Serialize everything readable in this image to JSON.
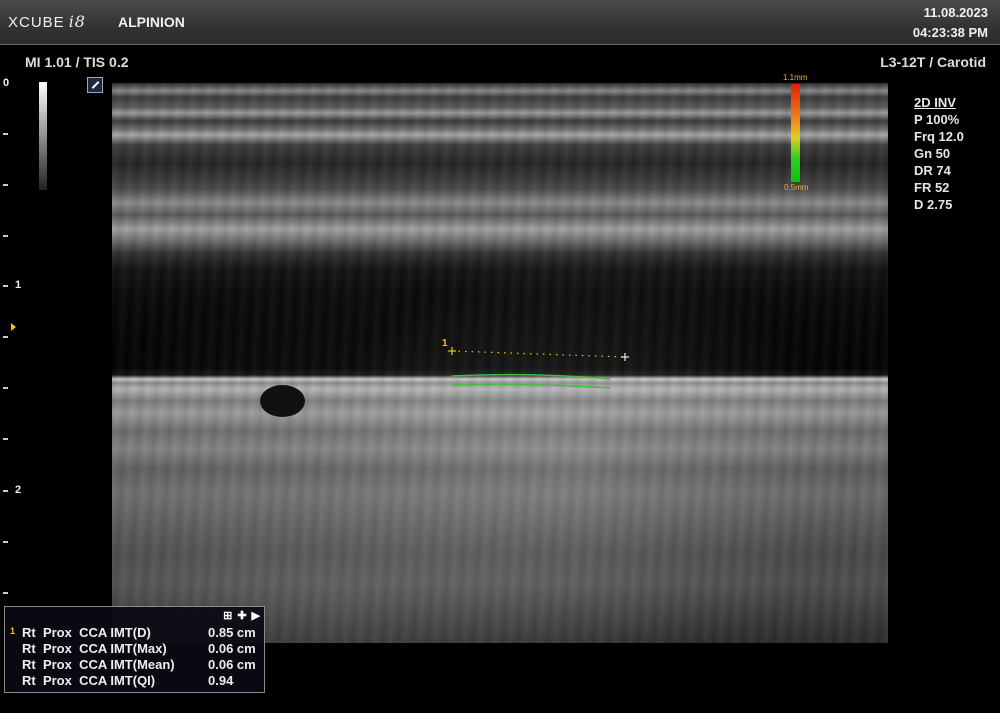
{
  "header": {
    "product": "XCUBE",
    "product_suffix": "i8",
    "manufacturer": "ALPINION",
    "date": "11.08.2023",
    "time": "04:23:38  PM"
  },
  "status": {
    "mi_tis": "MI 1.01 / TIS 0.2",
    "probe_preset": "L3-12T / Carotid"
  },
  "depth_scale": {
    "labels": [
      "0",
      "1",
      "2"
    ],
    "unit": "cm"
  },
  "colorbar": {
    "max_label": "1.1mm",
    "min_label": "0.5mm"
  },
  "imaging_params": {
    "mode": "2D INV",
    "power": "P 100%",
    "frequency": "Frq 12.0",
    "gain": "Gn 50",
    "dynamic_range": "DR 74",
    "frame_rate": "FR 52",
    "depth": "D 2.75"
  },
  "measurement": {
    "caliper_label": "1",
    "rows": [
      {
        "index": "1",
        "name": "Rt  Prox  CCA IMT(D)",
        "value": "0.85 cm"
      },
      {
        "index": "",
        "name": "Rt  Prox  CCA IMT(Max)",
        "value": "0.06 cm"
      },
      {
        "index": "",
        "name": "Rt  Prox  CCA IMT(Mean)",
        "value": "0.06 cm"
      },
      {
        "index": "",
        "name": "Rt  Prox  CCA IMT(QI)",
        "value": "0.94"
      }
    ],
    "toolbar_icons": [
      "grid-icon",
      "move-icon",
      "play-right-icon"
    ]
  },
  "colors": {
    "caliper": "#f1c40f",
    "trace": "#3fbf3f",
    "panel_border": "#8a8a8a"
  }
}
